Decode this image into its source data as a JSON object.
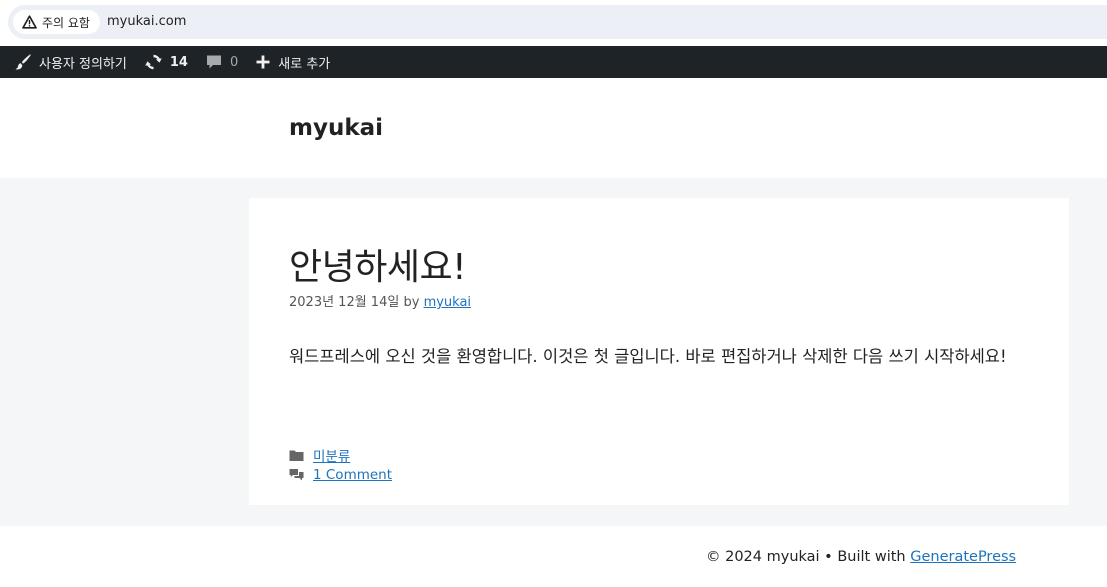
{
  "browser": {
    "security_label": "주의 요함",
    "url": "myukai.com"
  },
  "admin_bar": {
    "customize_label": "사용자 정의하기",
    "updates_count": "14",
    "comments_count": "0",
    "new_label": "새로 추가"
  },
  "site": {
    "title": "myukai"
  },
  "post": {
    "title": "안녕하세요!",
    "date": "2023년 12월 14일",
    "by": "by",
    "author": "myukai",
    "body": "워드프레스에 오신 것을 환영합니다. 이것은 첫 글입니다. 바로 편집하거나 삭제한 다음 쓰기 시작하세요!",
    "category": "미분류",
    "comments_link": "1 Comment"
  },
  "footer": {
    "copyright": "© 2024 myukai • Built with ",
    "theme_link": "GeneratePress"
  },
  "colors": {
    "admin_bar_bg": "#1d2327",
    "link": "#1e73be",
    "content_bg": "#f5f6f7"
  },
  "icons": {
    "security": "warning-triangle-icon",
    "customize": "paintbrush-icon",
    "updates": "refresh-icon",
    "comments": "speech-bubble-icon",
    "new": "plus-icon",
    "category": "folder-icon",
    "comment_link": "comments-icon"
  }
}
